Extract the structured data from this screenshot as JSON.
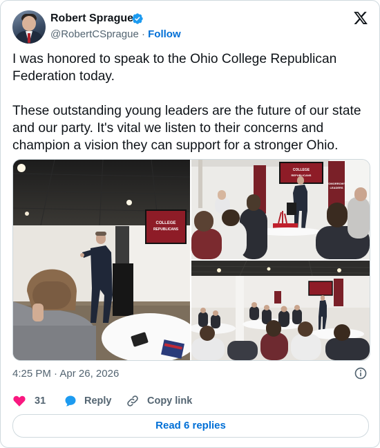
{
  "author": {
    "name": "Robert Sprague",
    "handle": "@RobertCSprague",
    "separator": "·",
    "follow_label": "Follow"
  },
  "post": {
    "paragraphs": [
      "I was honored to speak to the Ohio College Republican Federation today.",
      "These outstanding young leaders are the future of our state and our party. It's vital we listen to their concerns and champion a vision they can support for a stronger Ohio."
    ],
    "photos": [
      {
        "screen_text": [
          "COLLEGE",
          "REPUBLICANS"
        ]
      },
      {
        "screen_text": [
          "COLLEGE",
          "REPUBLICANS"
        ],
        "banner_text": [
          "TOMORROW'S",
          "LEADERS"
        ]
      },
      {
        "screen_text": []
      }
    ],
    "time": "4:25 PM",
    "date_separator": "·",
    "date": "Apr 26, 2026"
  },
  "actions": {
    "like_count": "31",
    "reply_label": "Reply",
    "copy_link_label": "Copy link"
  },
  "footer": {
    "read_replies_label": "Read 6 replies"
  },
  "colors": {
    "accent": "#006fd6",
    "like": "#f91880",
    "verified": "#1d9bf0",
    "muted": "#536471",
    "border": "#cfd9de"
  },
  "icons": [
    "verified-badge-icon",
    "x-logo-icon",
    "info-icon",
    "heart-icon",
    "reply-bubble-icon",
    "link-icon"
  ]
}
